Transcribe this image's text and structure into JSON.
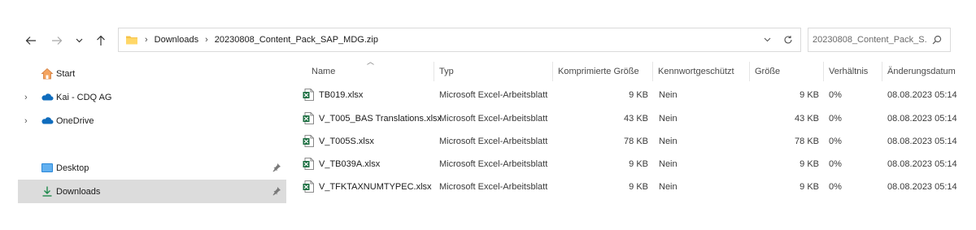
{
  "nav": {
    "back_icon": "arrow-left-icon",
    "forward_icon": "arrow-right-icon",
    "recent_icon": "chevron-down-icon",
    "up_icon": "arrow-up-icon"
  },
  "address": {
    "breadcrumbs": [
      "Downloads",
      "20230808_Content_Pack_SAP_MDG.zip"
    ]
  },
  "search": {
    "value": "20230808_Content_Pack_S..."
  },
  "sidebar": {
    "items": [
      {
        "label": "Start",
        "icon": "home-icon",
        "expandable": false
      },
      {
        "label": "Kai - CDQ AG",
        "icon": "onedrive-cloud-icon",
        "expandable": true
      },
      {
        "label": "OneDrive",
        "icon": "onedrive-cloud-icon",
        "expandable": true
      },
      {
        "label": "Desktop",
        "icon": "desktop-icon",
        "pinned": true
      },
      {
        "label": "Downloads",
        "icon": "download-icon",
        "pinned": true,
        "selected": true
      }
    ]
  },
  "columns": {
    "name": "Name",
    "type": "Typ",
    "compressed": "Komprimierte Größe",
    "password": "Kennwortgeschützt",
    "size": "Größe",
    "ratio": "Verhältnis",
    "modified": "Änderungsdatum"
  },
  "files": [
    {
      "name": "TB019.xlsx",
      "type": "Microsoft Excel-Arbeitsblatt",
      "compressed": "9 KB",
      "password": "Nein",
      "size": "9 KB",
      "ratio": "0%",
      "modified": "08.08.2023 05:14"
    },
    {
      "name": "V_T005_BAS Translations.xlsx",
      "type": "Microsoft Excel-Arbeitsblatt",
      "compressed": "43 KB",
      "password": "Nein",
      "size": "43 KB",
      "ratio": "0%",
      "modified": "08.08.2023 05:14"
    },
    {
      "name": "V_T005S.xlsx",
      "type": "Microsoft Excel-Arbeitsblatt",
      "compressed": "78 KB",
      "password": "Nein",
      "size": "78 KB",
      "ratio": "0%",
      "modified": "08.08.2023 05:14"
    },
    {
      "name": "V_TB039A.xlsx",
      "type": "Microsoft Excel-Arbeitsblatt",
      "compressed": "9 KB",
      "password": "Nein",
      "size": "9 KB",
      "ratio": "0%",
      "modified": "08.08.2023 05:14"
    },
    {
      "name": "V_TFKTAXNUMTYPEC.xlsx",
      "type": "Microsoft Excel-Arbeitsblatt",
      "compressed": "9 KB",
      "password": "Nein",
      "size": "9 KB",
      "ratio": "0%",
      "modified": "08.08.2023 05:14"
    }
  ],
  "colors": {
    "selected_bg": "#dcdcdc",
    "excel_green": "#1d6f42",
    "onedrive_blue": "#0f6cbd",
    "folder_yellow": "#f6c34a"
  }
}
